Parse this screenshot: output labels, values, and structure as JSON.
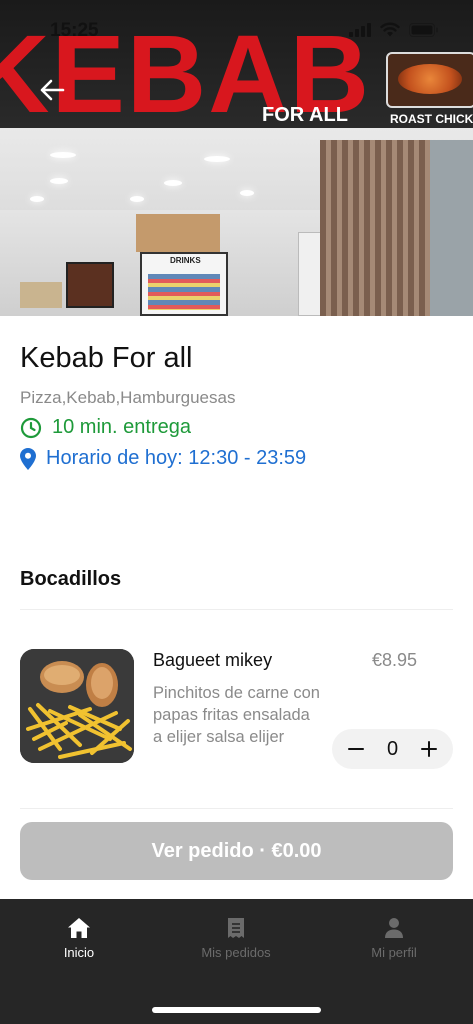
{
  "status_bar": {
    "time": "15:25"
  },
  "hero": {
    "sign_word": "KEBAB",
    "sign_sub": "FOR ALL",
    "sign_roast": "ROAST CHICKEN -",
    "drinks_label": "DRINKS"
  },
  "restaurant": {
    "name": "Kebab For all",
    "categories": "Pizza,Kebab,Hamburguesas",
    "delivery": "10 min. entrega",
    "hours": "Horario de hoy: 12:30 - 23:59",
    "colors": {
      "delivery": "#1e9a3a",
      "hours": "#1f6fd1"
    }
  },
  "section": {
    "title": "Bocadillos"
  },
  "items": [
    {
      "name": "Bagueet mikey",
      "price": "€8.95",
      "description": "Pinchitos de carne con papas fritas ensalada a elijer salsa elijer",
      "quantity": "0"
    }
  ],
  "order_button": {
    "label": "Ver pedido · €0.00"
  },
  "tabbar": {
    "tabs": [
      {
        "label": "Inicio",
        "icon": "home-icon",
        "active": true
      },
      {
        "label": "Mis pedidos",
        "icon": "receipt-icon",
        "active": false
      },
      {
        "label": "Mi perfil",
        "icon": "person-icon",
        "active": false
      }
    ]
  }
}
